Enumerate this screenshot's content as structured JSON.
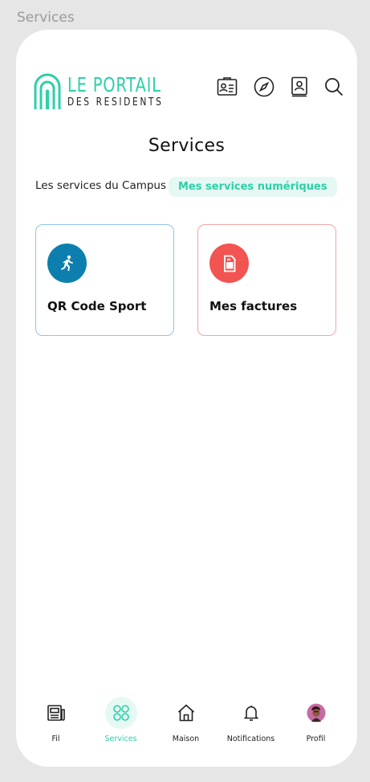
{
  "page": {
    "caption": "Services"
  },
  "header": {
    "logo_line1": "LE PORTAIL",
    "logo_line2": "DES RESIDENTS",
    "icons": [
      "id-card-icon",
      "compass-icon",
      "contact-book-icon",
      "search-icon"
    ]
  },
  "main": {
    "title": "Services",
    "tabs": [
      {
        "label": "Les services du Campus",
        "selected": false
      },
      {
        "label": "Mes services numériques",
        "selected": true
      }
    ],
    "cards": [
      {
        "label": "QR Code Sport",
        "icon": "runner-icon",
        "color": "#0d7fae"
      },
      {
        "label": "Mes factures",
        "icon": "invoice-icon",
        "color": "#f25451"
      }
    ]
  },
  "nav": {
    "items": [
      {
        "label": "Fil",
        "icon": "newspaper-icon",
        "active": false
      },
      {
        "label": "Services",
        "icon": "grid-circles-icon",
        "active": true
      },
      {
        "label": "Maison",
        "icon": "house-icon",
        "active": false
      },
      {
        "label": "Notifications",
        "icon": "bell-icon",
        "active": false
      },
      {
        "label": "Profil",
        "icon": "avatar",
        "active": false
      }
    ]
  },
  "colors": {
    "accent": "#2fcfa8",
    "accent_soft": "#e6f8f3",
    "sport": "#0d7fae",
    "bill": "#f25451"
  }
}
